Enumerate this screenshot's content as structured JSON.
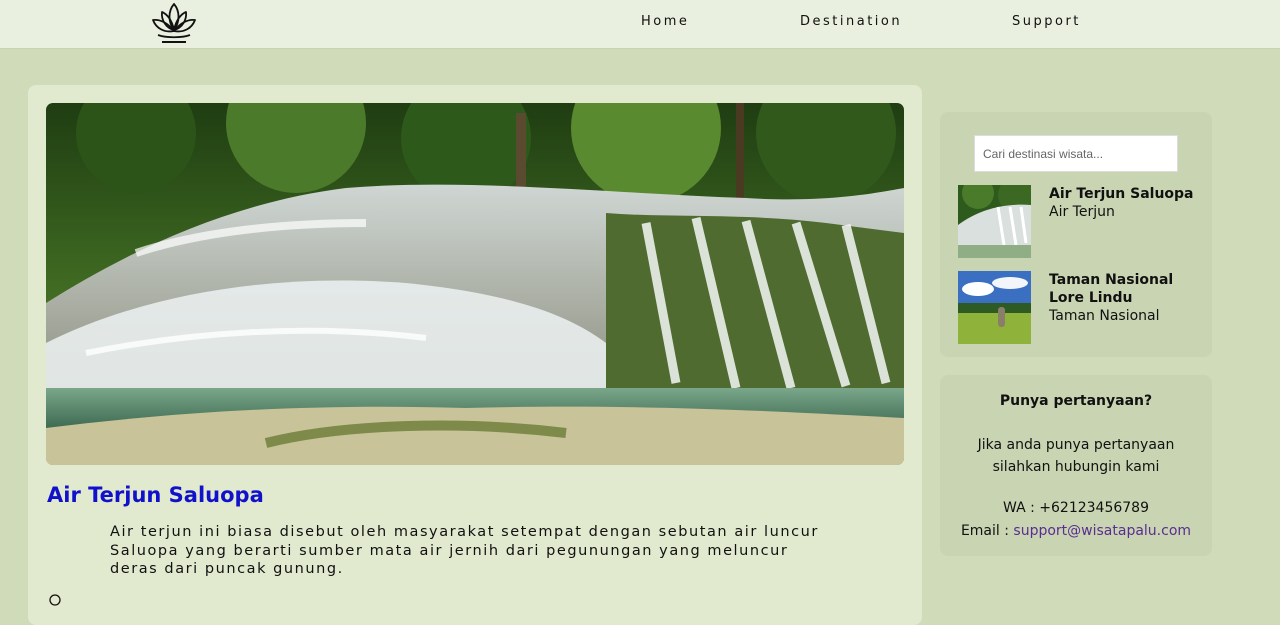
{
  "nav": {
    "home": "Home",
    "destination": "Destination",
    "support": "Support"
  },
  "logo": {
    "icon": "lotus-logo-icon"
  },
  "main": {
    "title": "Air Terjun Saluopa",
    "description": "Air terjun ini biasa disebut oleh masyarakat setempat dengan sebutan air luncur Saluopa yang berarti sumber mata air jernih dari pegunungan yang meluncur deras dari puncak gunung.",
    "title_color": "#1111cc"
  },
  "sidebar": {
    "search_placeholder": "Cari destinasi wisata...",
    "destinations": [
      {
        "name": "Air Terjun Saluopa",
        "category": "Air Terjun"
      },
      {
        "name": "Taman Nasional Lore Lindu",
        "category": "Taman Nasional"
      }
    ]
  },
  "contact": {
    "title": "Punya pertanyaan?",
    "text": "Jika anda punya pertanyaan silahkan hubungin kami",
    "wa": "WA : +62123456789",
    "email_label": "Email :",
    "email": "support@wisatapalu.com"
  }
}
